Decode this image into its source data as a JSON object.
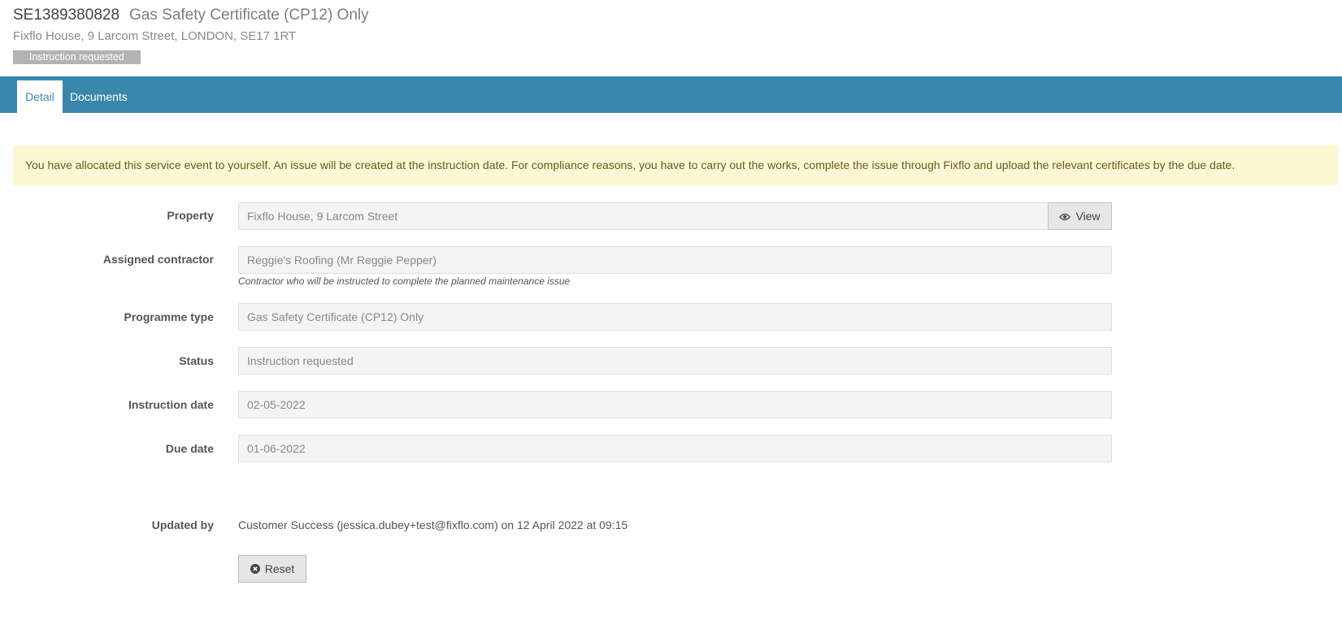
{
  "header": {
    "reference": "SE1389380828",
    "title": "Gas Safety Certificate (CP12) Only",
    "address": "Fixflo House, 9 Larcom Street, LONDON, SE17 1RT",
    "status_badge": "Instruction requested"
  },
  "tabs": [
    {
      "label": "Detail",
      "active": true
    },
    {
      "label": "Documents",
      "active": false
    }
  ],
  "alert": "You have allocated this service event to yourself. An issue will be created at the instruction date. For compliance reasons, you have to carry out the works, complete the issue through Fixflo and upload the relevant certificates by the due date.",
  "fields": {
    "property": {
      "label": "Property",
      "value": "Fixflo House, 9 Larcom Street",
      "button": "View",
      "button_icon": "eye-icon"
    },
    "contractor": {
      "label": "Assigned contractor",
      "value": "Reggie's Roofing (Mr Reggie Pepper)",
      "help": "Contractor who will be instructed to complete the planned maintenance issue"
    },
    "programme_type": {
      "label": "Programme type",
      "value": "Gas Safety Certificate (CP12) Only"
    },
    "status": {
      "label": "Status",
      "value": "Instruction requested"
    },
    "instruction_date": {
      "label": "Instruction date",
      "value": "02-05-2022"
    },
    "due_date": {
      "label": "Due date",
      "value": "01-06-2022"
    }
  },
  "updated": {
    "label": "Updated by",
    "value": "Customer Success (jessica.dubey+test@fixflo.com) on 12 April 2022 at 09:15"
  },
  "actions": {
    "reset_label": "Reset",
    "reset_icon": "close-circle-icon"
  },
  "colors": {
    "tab_bar": "#3a87ad",
    "alert_bg": "#fcf8d3",
    "badge_bg": "#b3b3b3",
    "field_bg": "#f4f4f4"
  }
}
